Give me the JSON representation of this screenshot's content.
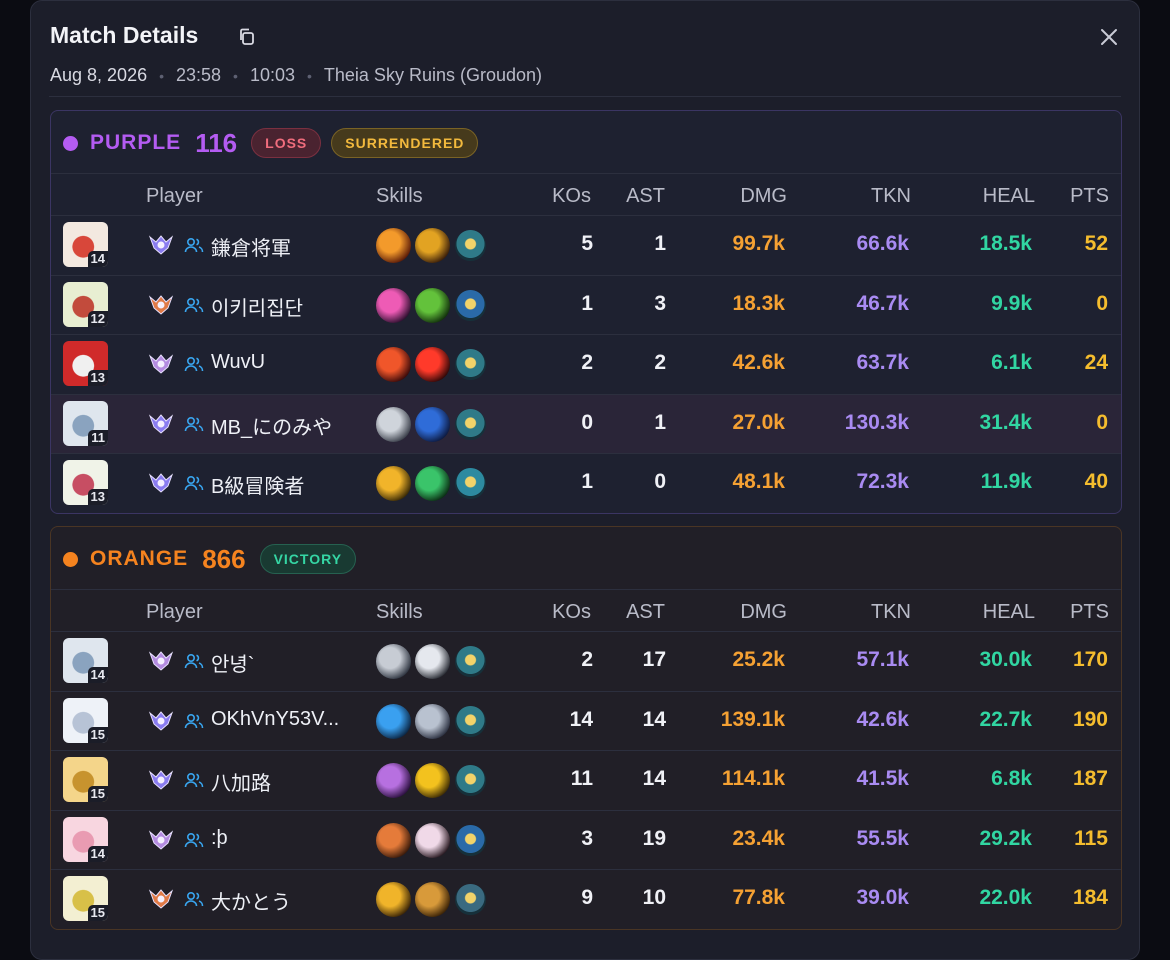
{
  "modal": {
    "title": "Match Details",
    "date": "Aug 8, 2026",
    "time": "23:58",
    "duration": "10:03",
    "map": "Theia Sky Ruins (Groudon)"
  },
  "columns": {
    "player": "Player",
    "skills": "Skills",
    "kos": "KOs",
    "ast": "AST",
    "dmg": "DMG",
    "tkn": "TKN",
    "heal": "HEAL",
    "pts": "PTS"
  },
  "colors": {
    "purple": "#b45cf2",
    "orange": "#f5831f",
    "dmg": "#f5a133",
    "tkn": "#a98bf2",
    "heal": "#31d6a2",
    "pts": "#f5bd2e"
  },
  "teams": [
    {
      "name": "PURPLE",
      "score": "116",
      "badges": [
        "LOSS",
        "SURRENDERED"
      ],
      "players": [
        {
          "level": "14",
          "name": "鎌倉将軍",
          "kos": "5",
          "ast": "1",
          "dmg": "99.7k",
          "tkn": "66.6k",
          "heal": "18.5k",
          "pts": "52"
        },
        {
          "level": "12",
          "name": "이키리집단",
          "kos": "1",
          "ast": "3",
          "dmg": "18.3k",
          "tkn": "46.7k",
          "heal": "9.9k",
          "pts": "0"
        },
        {
          "level": "13",
          "name": "WuvU",
          "kos": "2",
          "ast": "2",
          "dmg": "42.6k",
          "tkn": "63.7k",
          "heal": "6.1k",
          "pts": "24"
        },
        {
          "level": "11",
          "name": "MB_にのみや",
          "kos": "0",
          "ast": "1",
          "dmg": "27.0k",
          "tkn": "130.3k",
          "heal": "31.4k",
          "pts": "0"
        },
        {
          "level": "13",
          "name": "B級冒険者",
          "kos": "1",
          "ast": "0",
          "dmg": "48.1k",
          "tkn": "72.3k",
          "heal": "11.9k",
          "pts": "40"
        }
      ]
    },
    {
      "name": "ORANGE",
      "score": "866",
      "badges": [
        "VICTORY"
      ],
      "players": [
        {
          "level": "14",
          "name": "안녕`",
          "kos": "2",
          "ast": "17",
          "dmg": "25.2k",
          "tkn": "57.1k",
          "heal": "30.0k",
          "pts": "170"
        },
        {
          "level": "15",
          "name": "OKhVnY53V...",
          "kos": "14",
          "ast": "14",
          "dmg": "139.1k",
          "tkn": "42.6k",
          "heal": "22.7k",
          "pts": "190"
        },
        {
          "level": "15",
          "name": "八加路",
          "kos": "11",
          "ast": "14",
          "dmg": "114.1k",
          "tkn": "41.5k",
          "heal": "6.8k",
          "pts": "187"
        },
        {
          "level": "14",
          "name": ":þ",
          "kos": "3",
          "ast": "19",
          "dmg": "23.4k",
          "tkn": "55.5k",
          "heal": "29.2k",
          "pts": "115"
        },
        {
          "level": "15",
          "name": "大かとう",
          "kos": "9",
          "ast": "10",
          "dmg": "77.8k",
          "tkn": "39.0k",
          "heal": "22.0k",
          "pts": "184"
        }
      ]
    }
  ]
}
